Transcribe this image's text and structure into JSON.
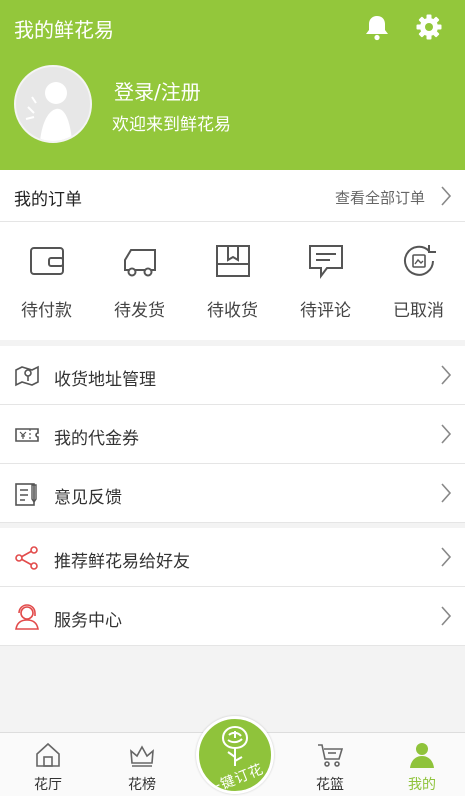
{
  "header": {
    "title": "我的鲜花易",
    "bell_icon": "bell-icon",
    "gear_icon": "gear-icon",
    "login_label": "登录/注册",
    "welcome": "欢迎来到鲜花易",
    "background": "#93c73b"
  },
  "orders": {
    "title": "我的订单",
    "view_all": "查看全部订单",
    "statuses": [
      {
        "label": "待付款",
        "icon": "wallet-icon"
      },
      {
        "label": "待发货",
        "icon": "truck-icon"
      },
      {
        "label": "待收货",
        "icon": "box-icon"
      },
      {
        "label": "待评论",
        "icon": "comment-icon"
      },
      {
        "label": "已取消",
        "icon": "cancel-icon"
      }
    ]
  },
  "menu1": [
    {
      "label": "收货地址管理",
      "icon": "map-icon"
    },
    {
      "label": "我的代金券",
      "icon": "voucher-icon"
    },
    {
      "label": "意见反馈",
      "icon": "feedback-icon"
    }
  ],
  "menu2": [
    {
      "label": "推荐鲜花易给好友",
      "icon": "share-icon"
    },
    {
      "label": "服务中心",
      "icon": "service-icon"
    }
  ],
  "tabbar": {
    "tabs": [
      {
        "label": "花厅",
        "icon": "home-icon"
      },
      {
        "label": "花榜",
        "icon": "crown-icon"
      },
      {
        "label": "花篮",
        "icon": "cart-icon"
      },
      {
        "label": "我的",
        "icon": "user-icon"
      }
    ],
    "center_label": "一键订花",
    "accent": "#8fc33b"
  }
}
